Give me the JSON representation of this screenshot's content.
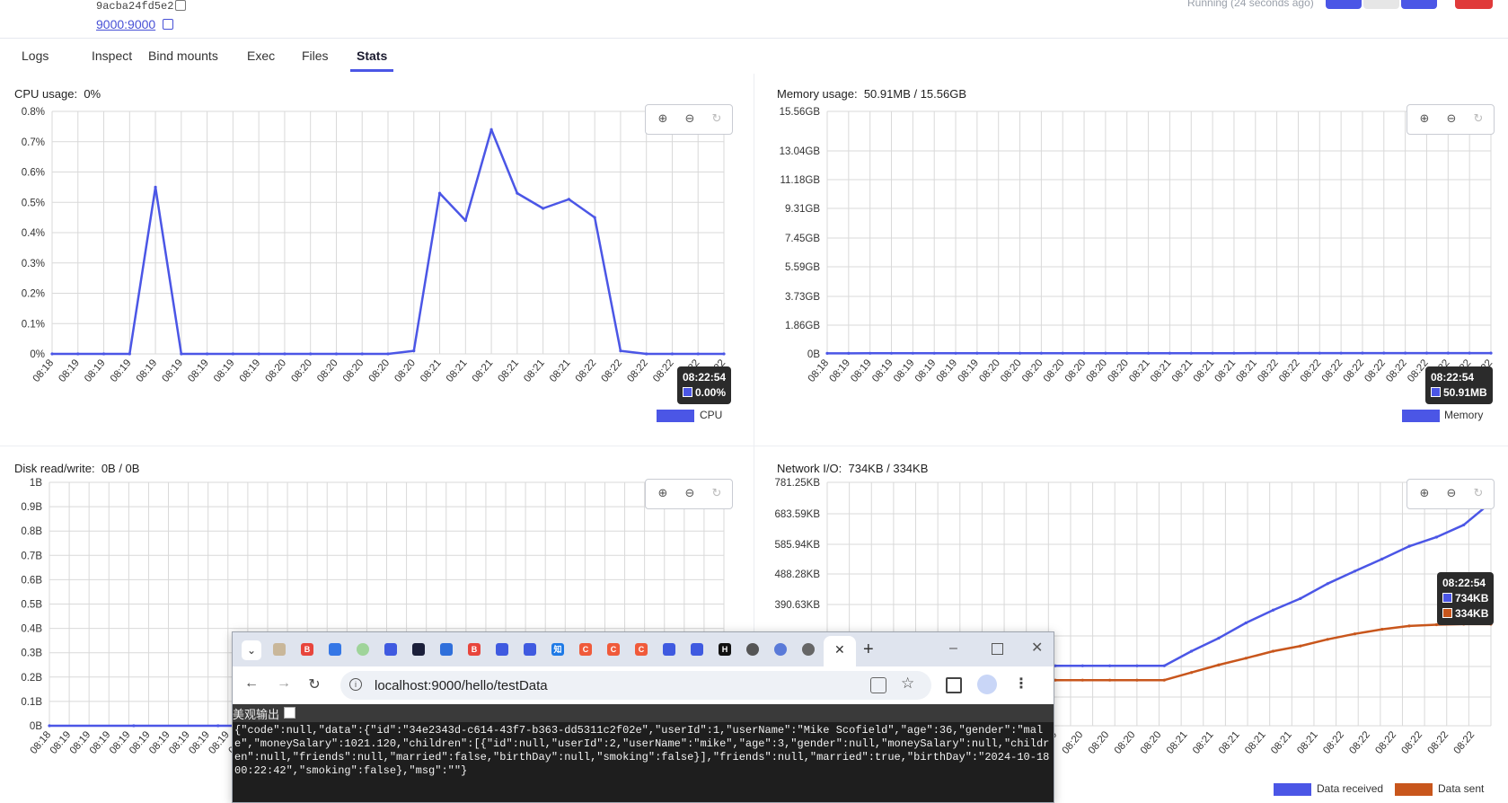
{
  "header": {
    "container_id": "9acba24fd5e2",
    "port_link": "9000:9000",
    "status": "Running (24 seconds ago)"
  },
  "tabs": [
    {
      "label": "Logs",
      "active": false
    },
    {
      "label": "Inspect",
      "active": false
    },
    {
      "label": "Bind mounts",
      "active": false
    },
    {
      "label": "Exec",
      "active": false
    },
    {
      "label": "Files",
      "active": false
    },
    {
      "label": "Stats",
      "active": true
    }
  ],
  "panels": {
    "cpu": {
      "label": "CPU usage:",
      "value": "0%",
      "legend": "CPU",
      "tip_time": "08:22:54",
      "tip_value": "0.00%"
    },
    "memory": {
      "label": "Memory usage:",
      "value": "50.91MB / 15.56GB",
      "legend": "Memory",
      "tip_time": "08:22:54",
      "tip_value": "50.91MB"
    },
    "disk": {
      "label": "Disk read/write:",
      "value": "0B / 0B"
    },
    "network": {
      "label": "Network I/O:",
      "value": "734KB / 334KB",
      "legend_rx": "Data received",
      "legend_tx": "Data sent",
      "tip_time": "08:22:54",
      "tip_rx": "734KB",
      "tip_tx": "334KB"
    }
  },
  "colors": {
    "primary": "#4b56e6",
    "sent": "#c8561c",
    "danger": "#e03a3a"
  },
  "chart_data": [
    {
      "type": "line",
      "title": "CPU usage",
      "x": [
        "08:18",
        "08:19",
        "08:19",
        "08:19",
        "08:19",
        "08:19",
        "08:19",
        "08:19",
        "08:19",
        "08:20",
        "08:20",
        "08:20",
        "08:20",
        "08:20",
        "08:20",
        "08:21",
        "08:21",
        "08:21",
        "08:21",
        "08:21",
        "08:21",
        "08:22",
        "08:22",
        "08:22",
        "08:22",
        "08:22",
        "08:22"
      ],
      "ylim": [
        0,
        0.8
      ],
      "y_ticks": [
        "0%",
        "0.1%",
        "0.2%",
        "0.3%",
        "0.4%",
        "0.5%",
        "0.6%",
        "0.7%",
        "0.8%"
      ],
      "series": [
        {
          "name": "CPU",
          "values": [
            0,
            0,
            0,
            0,
            0.55,
            0,
            0,
            0,
            0,
            0,
            0,
            0,
            0,
            0,
            0.01,
            0.53,
            0.44,
            0.74,
            0.53,
            0.48,
            0.51,
            0.45,
            0.01,
            0,
            0,
            0,
            0
          ]
        }
      ],
      "grid": true,
      "legend": "bottom-right"
    },
    {
      "type": "line",
      "title": "Memory usage",
      "x": [
        "08:18",
        "08:19",
        "08:19",
        "08:19",
        "08:19",
        "08:19",
        "08:19",
        "08:19",
        "08:20",
        "08:20",
        "08:20",
        "08:20",
        "08:20",
        "08:20",
        "08:20",
        "08:21",
        "08:21",
        "08:21",
        "08:21",
        "08:21",
        "08:21",
        "08:22",
        "08:22",
        "08:22",
        "08:22",
        "08:22",
        "08:22",
        "08:22",
        "08:22",
        "08:22",
        "08:22",
        "08:22"
      ],
      "y_ticks": [
        "0B",
        "1.86GB",
        "3.73GB",
        "5.59GB",
        "7.45GB",
        "9.31GB",
        "11.18GB",
        "13.04GB",
        "15.56GB"
      ],
      "series": [
        {
          "name": "Memory",
          "values_mb": [
            40,
            40,
            41,
            41,
            41,
            42,
            42,
            43,
            43,
            43,
            44,
            44,
            44,
            45,
            45,
            46,
            46,
            47,
            47,
            47,
            48,
            48,
            49,
            49,
            49,
            50,
            50,
            50,
            51,
            51,
            51,
            51
          ]
        }
      ],
      "grid": true,
      "legend": "bottom-right"
    },
    {
      "type": "line",
      "title": "Disk read/write",
      "x": [
        "08:18",
        "08:19",
        "08:19",
        "08:19",
        "08:19",
        "08:19",
        "08:19",
        "08:19",
        "08:19"
      ],
      "ylim": [
        0,
        1
      ],
      "y_ticks": [
        "0B",
        "0.1B",
        "0.2B",
        "0.3B",
        "0.4B",
        "0.5B",
        "0.6B",
        "0.7B",
        "0.8B",
        "0.9B",
        "1B"
      ],
      "series": [
        {
          "values": [
            0,
            0,
            0,
            0,
            0,
            0,
            0,
            0,
            0
          ]
        }
      ],
      "grid": true
    },
    {
      "type": "line",
      "title": "Network I/O",
      "x": [
        "08:20",
        "08:20",
        "08:20",
        "08:20",
        "08:20",
        "08:21",
        "08:21",
        "08:21",
        "08:21",
        "08:21",
        "08:21",
        "08:22",
        "08:22",
        "08:22",
        "08:22",
        "08:22",
        "08:22"
      ],
      "y_ticks": [
        "390.63KB",
        "488.28KB",
        "585.94KB",
        "683.59KB",
        "781.25KB"
      ],
      "series": [
        {
          "name": "Data received",
          "values_kb": [
            197,
            197,
            197,
            197,
            197,
            245,
            288,
            338,
            380,
            418,
            467,
            508,
            548,
            590,
            620,
            660,
            734
          ]
        },
        {
          "name": "Data sent",
          "values_kb": [
            150,
            150,
            150,
            150,
            150,
            175,
            200,
            222,
            245,
            262,
            284,
            302,
            317,
            328,
            332,
            334,
            334
          ]
        }
      ],
      "grid": true,
      "legend": "bottom-right"
    }
  ],
  "browser": {
    "tabs_icons": [
      "avatar-icon",
      "bilibili-icon",
      "tiktok-icon",
      "plant-icon",
      "baidu-icon",
      "tv-icon",
      "box-icon",
      "bilibili-icon",
      "baidu-icon",
      "baidu-icon",
      "zhihu-icon",
      "csdn-icon",
      "csdn-icon",
      "csdn-icon",
      "baidu-icon",
      "baidu-icon",
      "hackerrank-icon",
      "chrome-icon",
      "search-icon",
      "globe-icon"
    ],
    "tab_zhihu": "知",
    "tab_b": "B",
    "tab_c": "C",
    "tab_h": "H",
    "url": "localhost:9000/hello/testData",
    "pretty_print_label": "美观输出",
    "response_body": "{\"code\":null,\"data\":{\"id\":\"34e2343d-c614-43f7-b363-dd5311c2f02e\",\"userId\":1,\"userName\":\"Mike Scofield\",\"age\":36,\"gender\":\"male\",\"moneySalary\":1021.120,\"children\":[{\"id\":null,\"userId\":2,\"userName\":\"mike\",\"age\":3,\"gender\":null,\"moneySalary\":null,\"children\":null,\"friends\":null,\"married\":false,\"birthDay\":null,\"smoking\":false}],\"friends\":null,\"married\":true,\"birthDay\":\"2024-10-18 00:22:42\",\"smoking\":false},\"msg\":\"\"}"
  }
}
